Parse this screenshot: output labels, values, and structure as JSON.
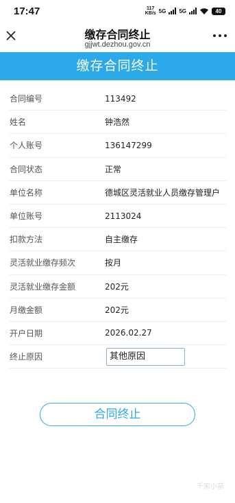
{
  "status_bar": {
    "time": "17:47",
    "net_speed_value": "117",
    "net_speed_unit": "KB/s",
    "net1": "5G",
    "net2": "5G",
    "battery": "40"
  },
  "title_bar": {
    "title": "缴存合同终止",
    "url": "gjjwt.dezhou.gov.cn",
    "close_icon": "close-icon",
    "more_icon": "more-icon"
  },
  "banner": {
    "title": "缴存合同终止"
  },
  "form": {
    "rows": [
      {
        "label": "合同编号",
        "value": "113492"
      },
      {
        "label": "姓名",
        "value": "钟浩然"
      },
      {
        "label": "个人账号",
        "value": "136147299"
      },
      {
        "label": "合同状态",
        "value": "正常"
      },
      {
        "label": "单位名称",
        "value": "德城区灵活就业人员缴存管理户"
      },
      {
        "label": "单位账号",
        "value": "2113024"
      },
      {
        "label": "扣款方法",
        "value": "自主缴存"
      },
      {
        "label": "灵活就业缴存频次",
        "value": "按月"
      },
      {
        "label": "灵活就业缴存金额",
        "value": "202元"
      },
      {
        "label": "月缴金额",
        "value": "202元"
      },
      {
        "label": "开户日期",
        "value": "2026.02.27"
      }
    ],
    "reason": {
      "label": "终止原因",
      "value": "其他原因"
    }
  },
  "submit": {
    "label": "合同终止"
  },
  "watermark": "千家小苗",
  "colors": {
    "accent": "#2ba9e9"
  }
}
